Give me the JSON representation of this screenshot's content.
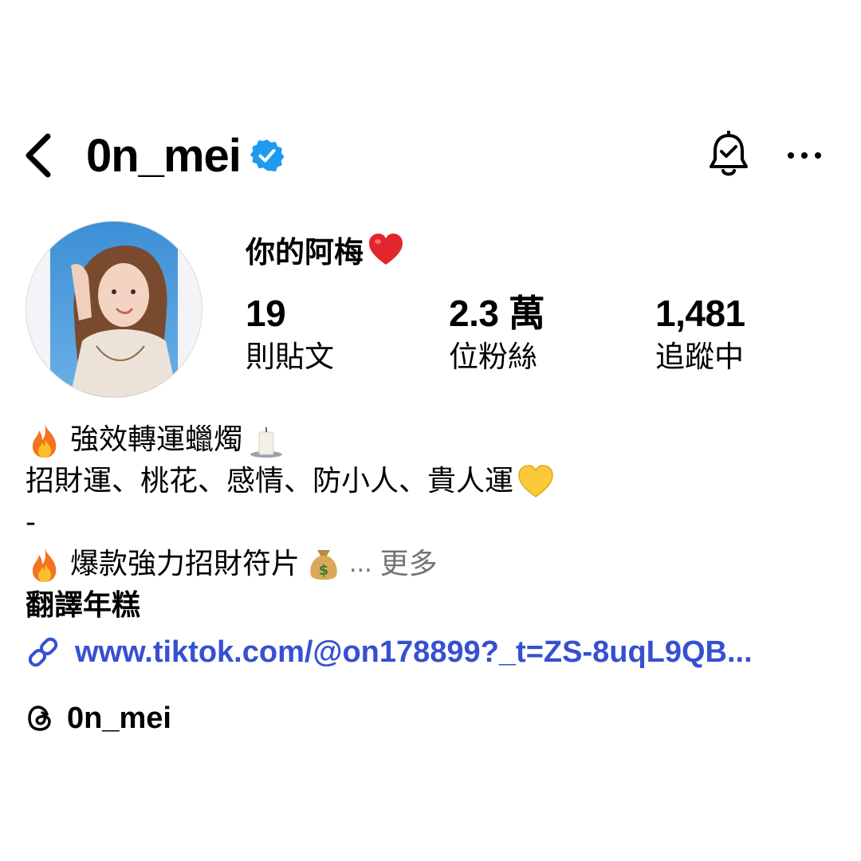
{
  "header": {
    "username": "0n_mei",
    "back_icon": "chevron-left-icon",
    "verified_icon": "verified-badge-icon",
    "bell_icon": "bell-check-icon",
    "more_icon": "more-dots-icon",
    "verified_color": "#1d9bf0"
  },
  "profile": {
    "display_name": "你的阿梅",
    "display_name_emoji": "red-heart-icon",
    "stats": [
      {
        "value": "19",
        "label": "則貼文"
      },
      {
        "value": "2.3 萬",
        "label": "位粉絲"
      },
      {
        "value": "1,481",
        "label": "追蹤中"
      }
    ]
  },
  "bio": {
    "line1": "強效轉運蠟燭",
    "line2": "招財運、桃花、感情、防小人、貴人運",
    "line3": "-",
    "line4": "爆款強力招財符片",
    "ellipsis": "...",
    "more_label": "更多",
    "category": "翻譯年糕"
  },
  "link": {
    "text": "www.tiktok.com/@on178899?_t=ZS-8uqL9QB...",
    "icon": "link-icon",
    "color": "#3650d0"
  },
  "threads": {
    "handle": "0n_mei",
    "icon": "threads-icon"
  }
}
